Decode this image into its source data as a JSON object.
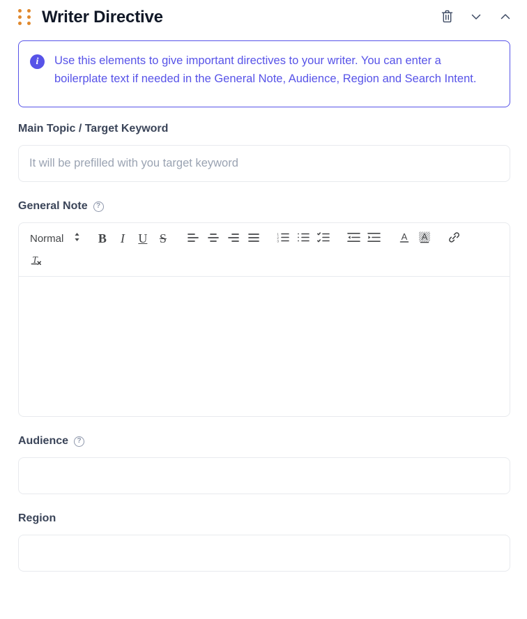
{
  "header": {
    "title": "Writer Directive",
    "drag_handle_icon": "drag-dots-icon",
    "drag_handle_color": "#e0892e",
    "actions": [
      {
        "name": "delete-button",
        "icon": "trash-icon"
      },
      {
        "name": "collapse-down-button",
        "icon": "chevron-down-icon"
      },
      {
        "name": "collapse-up-button",
        "icon": "chevron-up-icon"
      }
    ]
  },
  "banner": {
    "icon": "info-icon",
    "accent_color": "#5753e8",
    "text": "Use this elements to give important directives to your writer. You can enter a boilerplate text if needed in the General Note, Audience, Region and Search Intent."
  },
  "fields": {
    "main_topic": {
      "label": "Main Topic / Target Keyword",
      "placeholder": "It will be prefilled with you target keyword",
      "value": "",
      "has_help": false
    },
    "general_note": {
      "label": "General Note",
      "has_help": true,
      "help_icon": "question-circle-icon",
      "value": ""
    },
    "audience": {
      "label": "Audience",
      "has_help": true,
      "help_icon": "question-circle-icon",
      "placeholder": "",
      "value": ""
    },
    "region": {
      "label": "Region",
      "has_help": false,
      "placeholder": "",
      "value": ""
    }
  },
  "editor_toolbar": {
    "format_select": {
      "value": "Normal",
      "indicator_icon": "chevron-updown-icon"
    },
    "buttons": [
      {
        "name": "bold-button",
        "icon": "bold-icon",
        "glyph": "B"
      },
      {
        "name": "italic-button",
        "icon": "italic-icon",
        "glyph": "I"
      },
      {
        "name": "underline-button",
        "icon": "underline-icon",
        "glyph": "U"
      },
      {
        "name": "strikethrough-button",
        "icon": "strikethrough-icon",
        "glyph": "S"
      },
      {
        "name": "align-left-button",
        "icon": "align-left-icon"
      },
      {
        "name": "align-center-button",
        "icon": "align-center-icon"
      },
      {
        "name": "align-right-button",
        "icon": "align-right-icon"
      },
      {
        "name": "align-justify-button",
        "icon": "align-justify-icon"
      },
      {
        "name": "ordered-list-button",
        "icon": "ordered-list-icon"
      },
      {
        "name": "bullet-list-button",
        "icon": "bullet-list-icon"
      },
      {
        "name": "checklist-button",
        "icon": "checklist-icon"
      },
      {
        "name": "outdent-button",
        "icon": "outdent-icon"
      },
      {
        "name": "indent-button",
        "icon": "indent-icon"
      },
      {
        "name": "text-color-button",
        "icon": "text-color-icon"
      },
      {
        "name": "highlight-color-button",
        "icon": "highlight-color-icon"
      },
      {
        "name": "link-button",
        "icon": "link-icon"
      },
      {
        "name": "clear-format-button",
        "icon": "clear-formatting-icon"
      }
    ]
  }
}
